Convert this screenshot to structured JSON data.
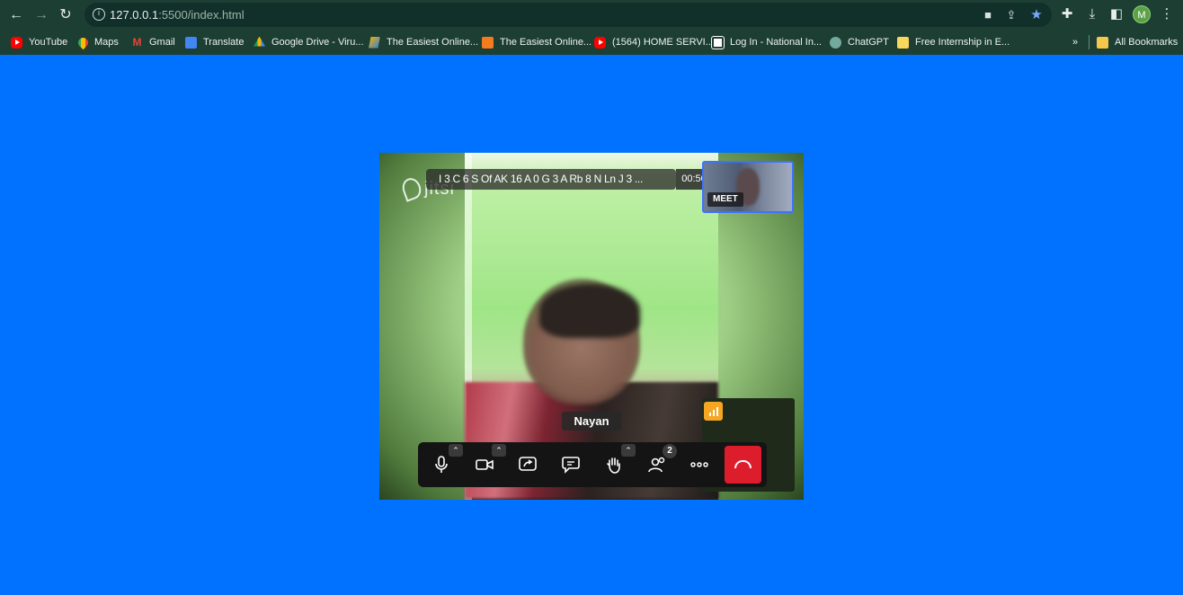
{
  "browser": {
    "url_host": "127.0.0.1",
    "url_rest": ":5500/index.html",
    "bookmarks": [
      {
        "label": "YouTube",
        "icon": "youtube-icon"
      },
      {
        "label": "Maps",
        "icon": "maps-icon"
      },
      {
        "label": "Gmail",
        "icon": "gmail-icon"
      },
      {
        "label": "Translate",
        "icon": "translate-icon"
      },
      {
        "label": "Google Drive - Viru...",
        "icon": "drive-icon"
      },
      {
        "label": "The Easiest Online...",
        "icon": "easiest-online-icon"
      },
      {
        "label": "The Easiest Online...",
        "icon": "easiest-online-icon"
      },
      {
        "label": "(1564) HOME SERVI...",
        "icon": "youtube-icon"
      },
      {
        "label": "Log In - National In...",
        "icon": "national-icon"
      },
      {
        "label": "ChatGPT",
        "icon": "chatgpt-icon"
      },
      {
        "label": "Free Internship in E...",
        "icon": "bookmark-page-icon"
      }
    ],
    "overflow_label": "»",
    "all_bookmarks_label": "All Bookmarks",
    "profile_initial": "M"
  },
  "meeting": {
    "subject": "I 3 C 6 S Of AK 16 A 0 G 3 A Rb 8 N Ln J 3 ...",
    "timer": "00:50",
    "brand": "jitsi",
    "self_label": "MEET",
    "speaker_name": "Nayan",
    "participants_count": "2"
  },
  "colors": {
    "page_background": "#0072ff",
    "hangup": "#dd1c2c",
    "connection_indicator": "#f5a623",
    "self_tile_border": "#3d73ff"
  }
}
